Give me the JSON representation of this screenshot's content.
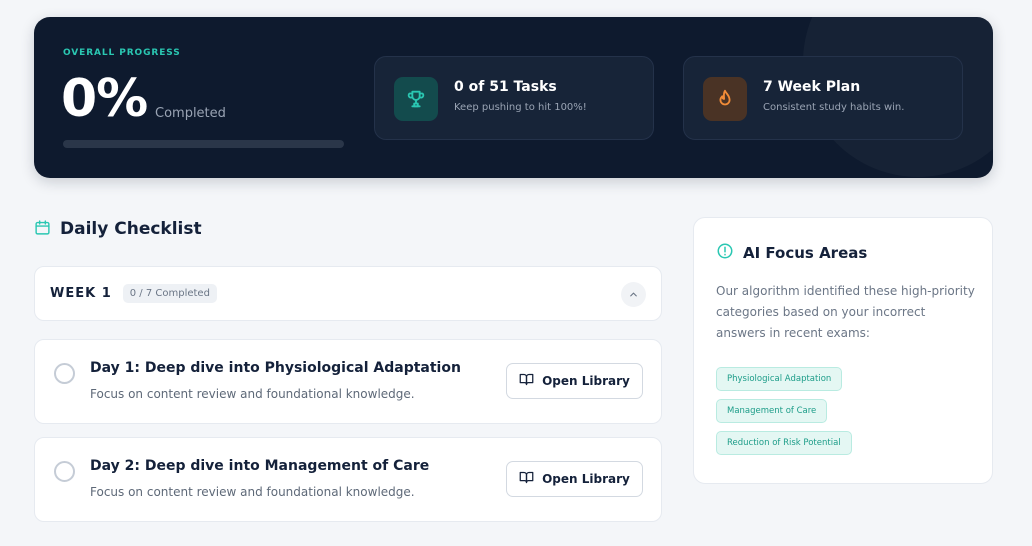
{
  "hero": {
    "label": "OVERALL PROGRESS",
    "percent": "0%",
    "percent_label": "Completed",
    "progress_fraction": 0
  },
  "stats": [
    {
      "title": "0 of 51 Tasks",
      "subtitle": "Keep pushing to hit 100%!",
      "icon": "trophy-icon",
      "color": "#2ac7b2"
    },
    {
      "title": "7 Week Plan",
      "subtitle": "Consistent study habits win.",
      "icon": "flame-icon",
      "color": "#f28c38"
    }
  ],
  "checklist": {
    "title": "Daily Checklist",
    "icon": "calendar-icon",
    "week": {
      "label": "WEEK 1",
      "badge": "0 / 7 Completed"
    },
    "tasks": [
      {
        "title": "Day 1: Deep dive into Physiological Adaptation",
        "description": "Focus on content review and foundational knowledge.",
        "button": "Open Library"
      },
      {
        "title": "Day 2: Deep dive into Management of Care",
        "description": "Focus on content review and foundational knowledge.",
        "button": "Open Library"
      }
    ]
  },
  "focus": {
    "title": "AI Focus Areas",
    "icon": "alert-circle-icon",
    "description": "Our algorithm identified these high-priority categories based on your incorrect answers in recent exams:",
    "tags": [
      "Physiological Adaptation",
      "Management of Care",
      "Reduction of Risk Potential"
    ]
  },
  "colors": {
    "accent": "#2ac7b2",
    "hero_bg": "#0e1a2e",
    "flame": "#f28c38"
  }
}
